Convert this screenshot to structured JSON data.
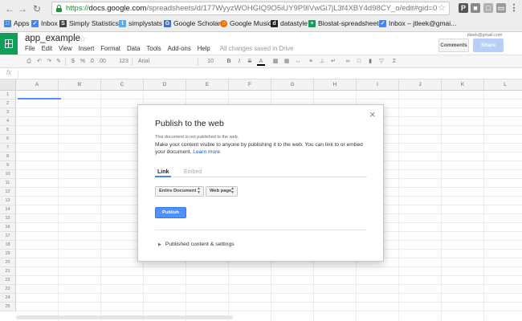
{
  "browser": {
    "url_protocol": "https://",
    "url_host": "docs.google.com",
    "url_path": "/spreadsheets/d/177WyyzWOHGIQ9O5iUY9P9IVwGi7jL3f4XBY4d98CY_o/edit#gid=0",
    "bookmarks": [
      "Apps",
      "Inbox",
      "Simply Statistics",
      "simplystats",
      "Google Scholar",
      "Google Music",
      "datastyle",
      "Biostat-spreadsheet",
      "Inbox – jtleek@gmai..."
    ]
  },
  "sheets": {
    "title": "app_example",
    "account": "jtleek@gmail.com",
    "menu": [
      "File",
      "Edit",
      "View",
      "Insert",
      "Format",
      "Data",
      "Tools",
      "Add-ons",
      "Help"
    ],
    "saved_status": "All changes saved in Drive",
    "comments_label": "Comments",
    "share_label": "Share",
    "toolbar": {
      "zoom_number_format": "123",
      "font": "Arial",
      "font_size": "10",
      "bold": "B",
      "italic": "I",
      "strike": "S",
      "text_color": "A"
    },
    "fx_label": "fx",
    "columns": [
      "A",
      "B",
      "C",
      "D",
      "E",
      "F",
      "G",
      "H",
      "I",
      "J",
      "K",
      "L"
    ],
    "rows": [
      "1",
      "2",
      "3",
      "4",
      "5",
      "6",
      "7",
      "8",
      "9",
      "10",
      "11",
      "12",
      "13",
      "14",
      "15",
      "16",
      "17",
      "18",
      "19",
      "20",
      "21",
      "22",
      "23",
      "24",
      "25"
    ]
  },
  "publish_dialog": {
    "title": "Publish to the web",
    "status_note": "This document is not published to the web.",
    "description": "Make your content visible to anyone by publishing it to the web. You can link to or embed your document.",
    "learn_more": "Learn more",
    "tab_link": "Link",
    "tab_embed": "Embed",
    "scope_select": "Entire Document",
    "format_select": "Web page",
    "publish_button": "Publish",
    "settings_label": "Published content & settings",
    "close_glyph": "×"
  },
  "colors": {
    "accent_blue": "#4d90fe",
    "sheets_green": "#0f9d58",
    "link_blue": "#1155cc"
  }
}
